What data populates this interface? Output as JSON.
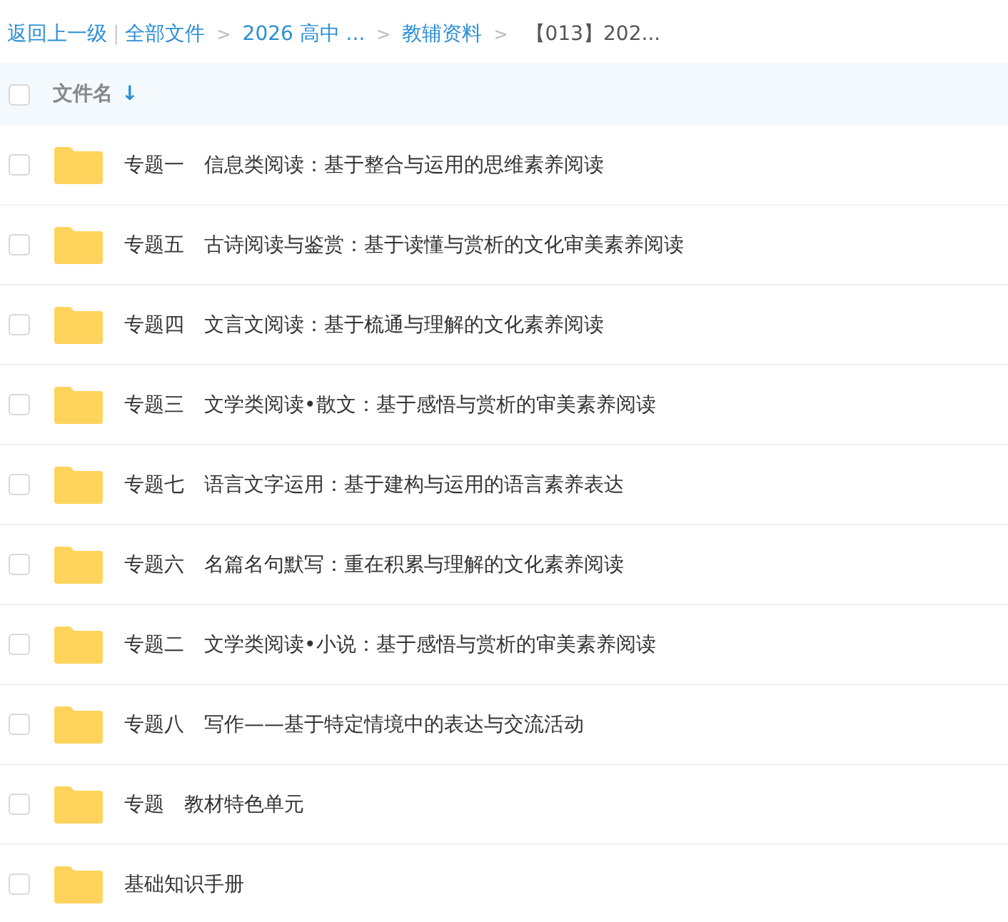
{
  "breadcrumb": {
    "back": "返回上一级",
    "divider": "|",
    "items": [
      {
        "label": "全部文件",
        "current": false
      },
      {
        "label": "2026 高中 ...",
        "current": false
      },
      {
        "label": "教辅资料",
        "current": false
      },
      {
        "label": "【013】202...",
        "current": true
      }
    ],
    "separator": ">"
  },
  "header": {
    "checked": false,
    "column": "文件名",
    "sort_icon": "↓"
  },
  "files": [
    {
      "name": "专题一　信息类阅读：基于整合与运用的思维素养阅读",
      "checked": false
    },
    {
      "name": "专题五　古诗阅读与鉴赏：基于读懂与赏析的文化审美素养阅读",
      "checked": false
    },
    {
      "name": "专题四　文言文阅读：基于梳通与理解的文化素养阅读",
      "checked": false
    },
    {
      "name": "专题三　文学类阅读•散文：基于感悟与赏析的审美素养阅读",
      "checked": false
    },
    {
      "name": "专题七　语言文字运用：基于建构与运用的语言素养表达",
      "checked": false
    },
    {
      "name": "专题六　名篇名句默写：重在积累与理解的文化素养阅读",
      "checked": false
    },
    {
      "name": "专题二　文学类阅读•小说：基于感悟与赏析的审美素养阅读",
      "checked": false
    },
    {
      "name": "专题八　写作——基于特定情境中的表达与交流活动",
      "checked": false
    },
    {
      "name": "专题　教材特色单元",
      "checked": false
    },
    {
      "name": "基础知识手册",
      "checked": false
    }
  ]
}
